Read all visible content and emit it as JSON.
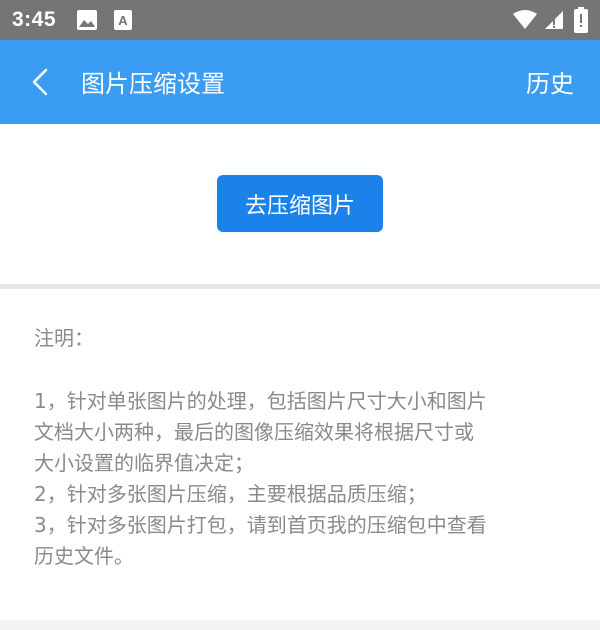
{
  "status_bar": {
    "time": "3:45",
    "icons": [
      "image-icon",
      "font-a-icon",
      "wifi-icon",
      "signal-icon",
      "battery-icon"
    ]
  },
  "app_bar": {
    "title": "图片压缩设置",
    "history_label": "历史",
    "background": "#3b9cf4"
  },
  "main": {
    "compress_button_label": "去压缩图片",
    "button_color": "#1b82ea"
  },
  "notes": {
    "title": "注明：",
    "lines": [
      "1，针对单张图片的处理，包括图片尺寸大小和图片",
      "文档大小两种，最后的图像压缩效果将根据尺寸或",
      "大小设置的临界值决定；",
      "2，针对多张图片压缩，主要根据品质压缩；",
      "3，针对多张图片打包，请到首页我的压缩包中查看",
      "历史文件。"
    ]
  }
}
